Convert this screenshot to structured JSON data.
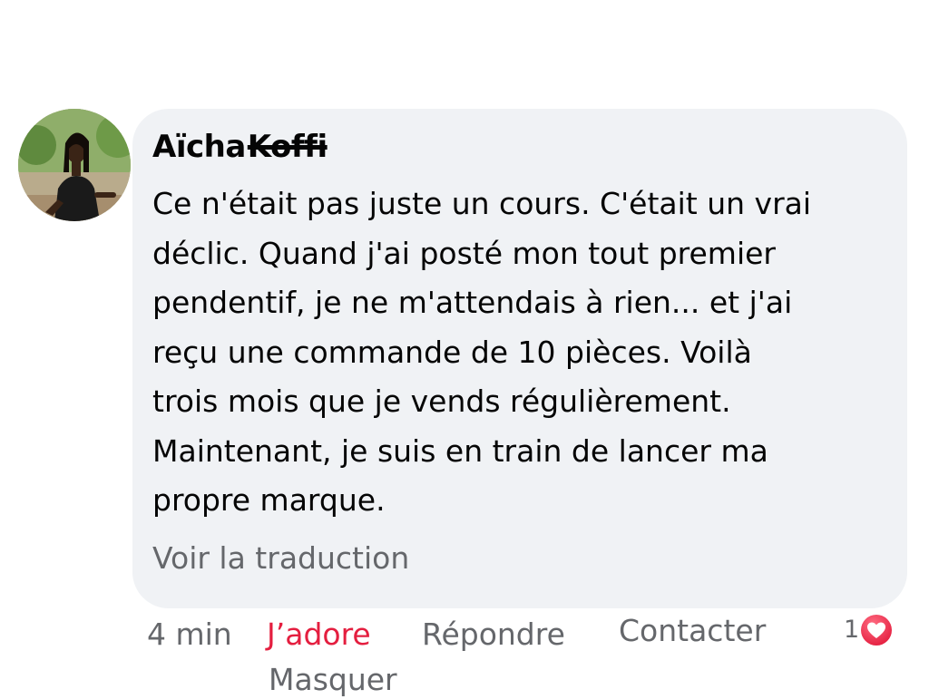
{
  "comment": {
    "author_first": "Aïcha",
    "author_last": "Koffi",
    "avatar_icon": "profile-photo",
    "text_lines": [
      "Ce n'était pas juste un cours. C'était un vrai",
      "déclic. Quand j'ai posté mon tout premier",
      "pendentif, je ne m'attendais à rien... et j'ai",
      "reçu une commande de 10 pièces. Voilà",
      "trois mois que je vends régulièrement.",
      "Maintenant, je suis en train de lancer ma",
      "propre marque."
    ],
    "translate_label": "Voir la traduction"
  },
  "actions": {
    "time": "4 min",
    "love_label": "J’adore",
    "reply_label": "Répondre",
    "contact_label": "Contacter",
    "hide_label": "Masquer"
  },
  "reactions": {
    "count": "1",
    "icon": "love-heart-icon"
  },
  "colors": {
    "bubble": "#f0f2f5",
    "love_red": "#e41e3f",
    "secondary_text": "#65676b"
  }
}
